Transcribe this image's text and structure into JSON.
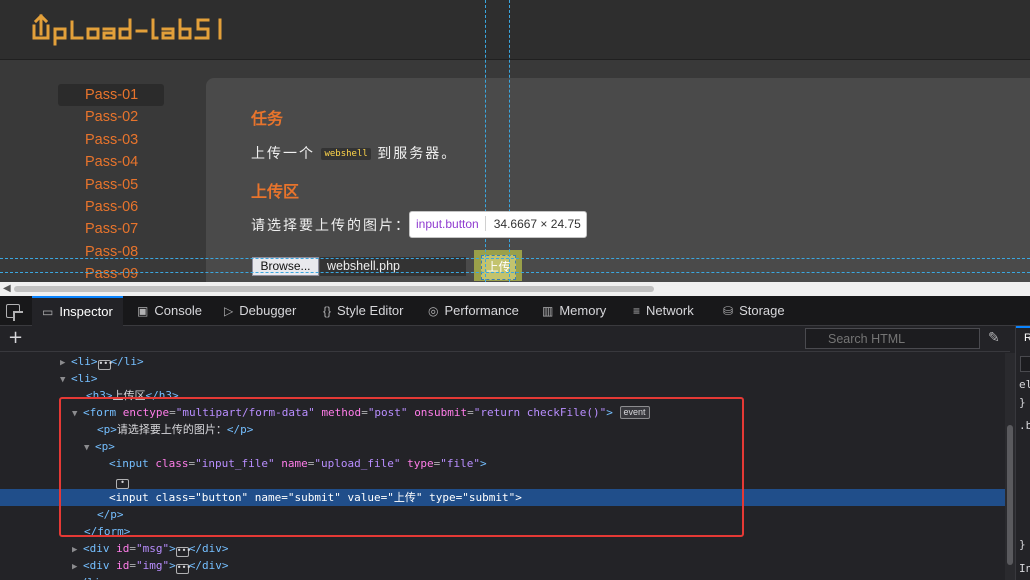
{
  "page": {
    "logo_text": "Upload-labs",
    "sidebar": [
      "Pass-01",
      "Pass-02",
      "Pass-03",
      "Pass-04",
      "Pass-05",
      "Pass-06",
      "Pass-07",
      "Pass-08",
      "Pass-09"
    ],
    "task_heading": "任务",
    "task_text_before": "上传一个",
    "task_code": "webshell",
    "task_text_after": "到服务器。",
    "upload_heading": "上传区",
    "upload_prompt": "请选择要上传的图片：",
    "browse_label": "Browse...",
    "file_name": "webshell.php",
    "upload_button": "上传"
  },
  "tooltip": {
    "selector": "input.button",
    "dimensions": "34.6667 × 24.75"
  },
  "devtools": {
    "tabs": [
      {
        "label": "Inspector",
        "icon": "inspector-icon"
      },
      {
        "label": "Console",
        "icon": "console-icon"
      },
      {
        "label": "Debugger",
        "icon": "debugger-icon"
      },
      {
        "label": "Style Editor",
        "icon": "braces-icon"
      },
      {
        "label": "Performance",
        "icon": "gauge-icon"
      },
      {
        "label": "Memory",
        "icon": "memory-icon"
      },
      {
        "label": "Network",
        "icon": "network-icon"
      },
      {
        "label": "Storage",
        "icon": "storage-icon"
      }
    ],
    "search_placeholder": "Search HTML",
    "markup": {
      "li": "li",
      "h3": "h3",
      "h3_text": "上传区",
      "form": "form",
      "form_enctype_name": "enctype",
      "form_enctype_val": "\"multipart/form-data\"",
      "form_method_name": "method",
      "form_method_val": "\"post\"",
      "form_onsubmit_name": "onsubmit",
      "form_onsubmit_val": "\"return checkFile()\"",
      "event_badge": "event",
      "p": "p",
      "p_text": "请选择要上传的图片：",
      "input": "input",
      "input_file_class_name": "class",
      "input_file_class_val": "\"input_file\"",
      "input_file_name_name": "name",
      "input_file_name_val": "\"upload_file\"",
      "input_file_type_name": "type",
      "input_file_type_val": "\"file\"",
      "btn_class_name": "class",
      "btn_class_val": "\"button\"",
      "btn_name_name": "name",
      "btn_name_val": "\"submit\"",
      "btn_value_name": "value",
      "btn_value_val": "\"上传\"",
      "btn_type_name": "type",
      "btn_type_val": "\"submit\"",
      "div": "div",
      "div_msg_name": "id",
      "div_msg_val": "\"msg\"",
      "div_img_name": "id",
      "div_img_val": "\"img\""
    },
    "rules_tab_initial": "R",
    "rules_lines": [
      "el",
      "}",
      ".b",
      "}",
      "In"
    ]
  }
}
